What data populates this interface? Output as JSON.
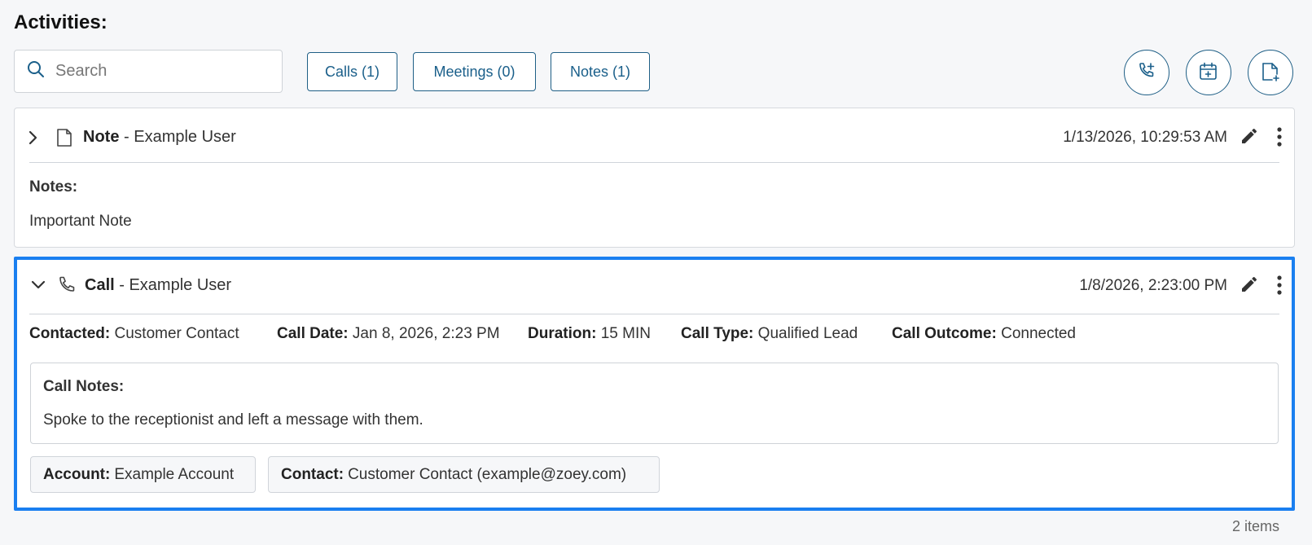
{
  "header": {
    "title": "Activities:"
  },
  "search": {
    "placeholder": "Search"
  },
  "filters": [
    {
      "label": "Calls (1)"
    },
    {
      "label": "Meetings (0)"
    },
    {
      "label": "Notes (1)"
    }
  ],
  "actions": [
    {
      "icon": "add-call-icon"
    },
    {
      "icon": "add-meeting-icon"
    },
    {
      "icon": "add-note-icon"
    }
  ],
  "activities": [
    {
      "type": "Note",
      "separator": " - ",
      "user": "Example User",
      "timestamp": "1/13/2026, 10:29:53 AM",
      "expanded": false,
      "notes_label": "Notes:",
      "notes_text": "Important Note"
    },
    {
      "type": "Call",
      "separator": " - ",
      "user": "Example User",
      "timestamp": "1/8/2026, 2:23:00 PM",
      "expanded": true,
      "selected": true,
      "fields": [
        {
          "label": "Contacted:",
          "value": "Customer Contact"
        },
        {
          "label": "Call Date:",
          "value": "Jan 8, 2026, 2:23 PM"
        },
        {
          "label": "Duration:",
          "value": "15 MIN"
        },
        {
          "label": "Call Type:",
          "value": "Qualified Lead"
        },
        {
          "label": "Call Outcome:",
          "value": "Connected"
        }
      ],
      "call_notes_label": "Call Notes:",
      "call_notes_text": "Spoke to the receptionist and left a message with them.",
      "chips": [
        {
          "label": "Account:",
          "value": "Example Account"
        },
        {
          "label": "Contact:",
          "value": "Customer Contact (example@zoey.com)"
        }
      ]
    }
  ],
  "footer": {
    "count": "2 items"
  },
  "colors": {
    "accent": "#1a5f8a",
    "selected_border": "#1a7ff0"
  }
}
